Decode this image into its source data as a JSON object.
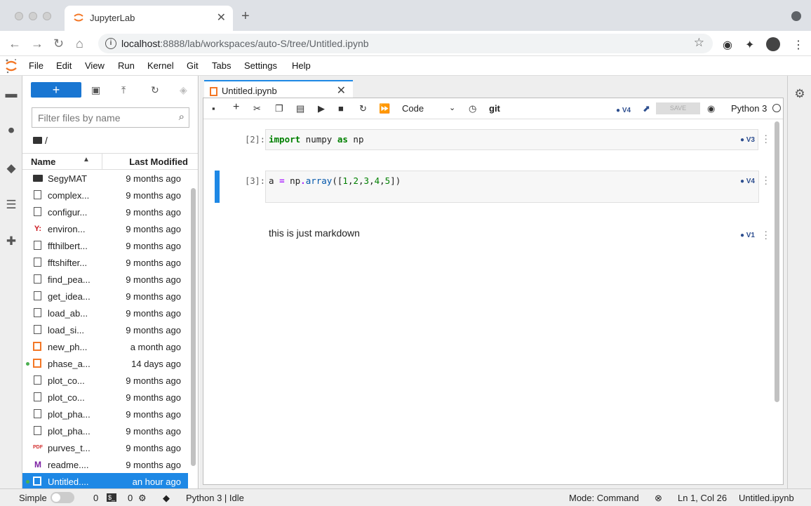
{
  "browser": {
    "tab_title": "JupyterLab",
    "new_tab": "+",
    "url_host": "localhost",
    "url_rest": ":8888/lab/workspaces/auto-S/tree/Untitled.ipynb"
  },
  "menubar": [
    "File",
    "Edit",
    "View",
    "Run",
    "Kernel",
    "Git",
    "Tabs",
    "Settings",
    "Help"
  ],
  "filebrowser": {
    "new_label": "+",
    "filter_placeholder": "Filter files by name",
    "breadcrumb": "/",
    "col_name": "Name",
    "col_modified": "Last Modified",
    "files": [
      {
        "name": "SegyMAT",
        "modified": "9 months ago",
        "icon": "folder-icon"
      },
      {
        "name": "complex...",
        "modified": "9 months ago",
        "icon": "file-icon"
      },
      {
        "name": "configur...",
        "modified": "9 months ago",
        "icon": "file-icon"
      },
      {
        "name": "environ...",
        "modified": "9 months ago",
        "icon": "yaml-icon"
      },
      {
        "name": "ffthilbert...",
        "modified": "9 months ago",
        "icon": "file-icon"
      },
      {
        "name": "fftshifter...",
        "modified": "9 months ago",
        "icon": "file-icon"
      },
      {
        "name": "find_pea...",
        "modified": "9 months ago",
        "icon": "file-icon"
      },
      {
        "name": "get_idea...",
        "modified": "9 months ago",
        "icon": "file-icon"
      },
      {
        "name": "load_ab...",
        "modified": "9 months ago",
        "icon": "file-icon"
      },
      {
        "name": "load_si...",
        "modified": "9 months ago",
        "icon": "file-icon"
      },
      {
        "name": "new_ph...",
        "modified": "a month ago",
        "icon": "notebook-icon"
      },
      {
        "name": "phase_a...",
        "modified": "14 days ago",
        "icon": "notebook-icon"
      },
      {
        "name": "plot_co...",
        "modified": "9 months ago",
        "icon": "file-icon"
      },
      {
        "name": "plot_co...",
        "modified": "9 months ago",
        "icon": "file-icon"
      },
      {
        "name": "plot_pha...",
        "modified": "9 months ago",
        "icon": "file-icon"
      },
      {
        "name": "plot_pha...",
        "modified": "9 months ago",
        "icon": "file-icon"
      },
      {
        "name": "purves_t...",
        "modified": "9 months ago",
        "icon": "pdf-icon"
      },
      {
        "name": "readme....",
        "modified": "9 months ago",
        "icon": "markdown-icon"
      },
      {
        "name": "Untitled....",
        "modified": "an hour ago",
        "icon": "notebook-icon"
      }
    ]
  },
  "notebook": {
    "tab_title": "Untitled.ipynb",
    "cell_type": "Code",
    "git_label": "git",
    "toolbar_version": "V4",
    "save_label": "SAVE",
    "kernel": "Python 3",
    "cells": [
      {
        "prompt": "[2]:",
        "version": "V3"
      },
      {
        "prompt": "[3]:",
        "version": "V4"
      },
      {
        "markdown": "this is just markdown",
        "version": "V1"
      }
    ]
  },
  "status": {
    "mode_label": "Simple",
    "terminals": "0",
    "kernels": "0",
    "kernel_status": "Python 3 | Idle",
    "mode": "Mode: Command",
    "cursor": "Ln 1, Col 26",
    "file": "Untitled.ipynb"
  },
  "colors": {
    "accent": "#1e88e5",
    "jupyter_orange": "#f37726"
  }
}
